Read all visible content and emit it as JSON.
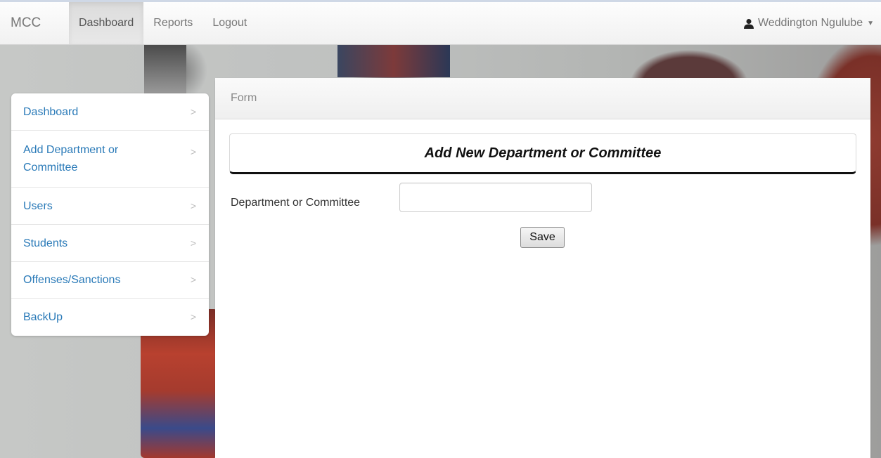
{
  "navbar": {
    "brand": "MCC",
    "links": [
      "Dashboard",
      "Reports",
      "Logout"
    ],
    "active_link": "Dashboard",
    "user_name": "Weddington Ngulube",
    "user_icon": "user-icon",
    "caret_icon": "caret-down-icon"
  },
  "sidebar": {
    "items": [
      {
        "label": "Dashboard"
      },
      {
        "label": "Add Department or Committee"
      },
      {
        "label": "Users"
      },
      {
        "label": "Students"
      },
      {
        "label": "Offenses/Sanctions"
      },
      {
        "label": "BackUp"
      }
    ],
    "chevron_icon": "chevron-right-icon",
    "link_color": "#2a7ab8"
  },
  "panel": {
    "heading": "Form",
    "form_title": "Add New Department or Committee",
    "field_label": "Department or Committee",
    "field_value": "",
    "save_label": "Save"
  }
}
